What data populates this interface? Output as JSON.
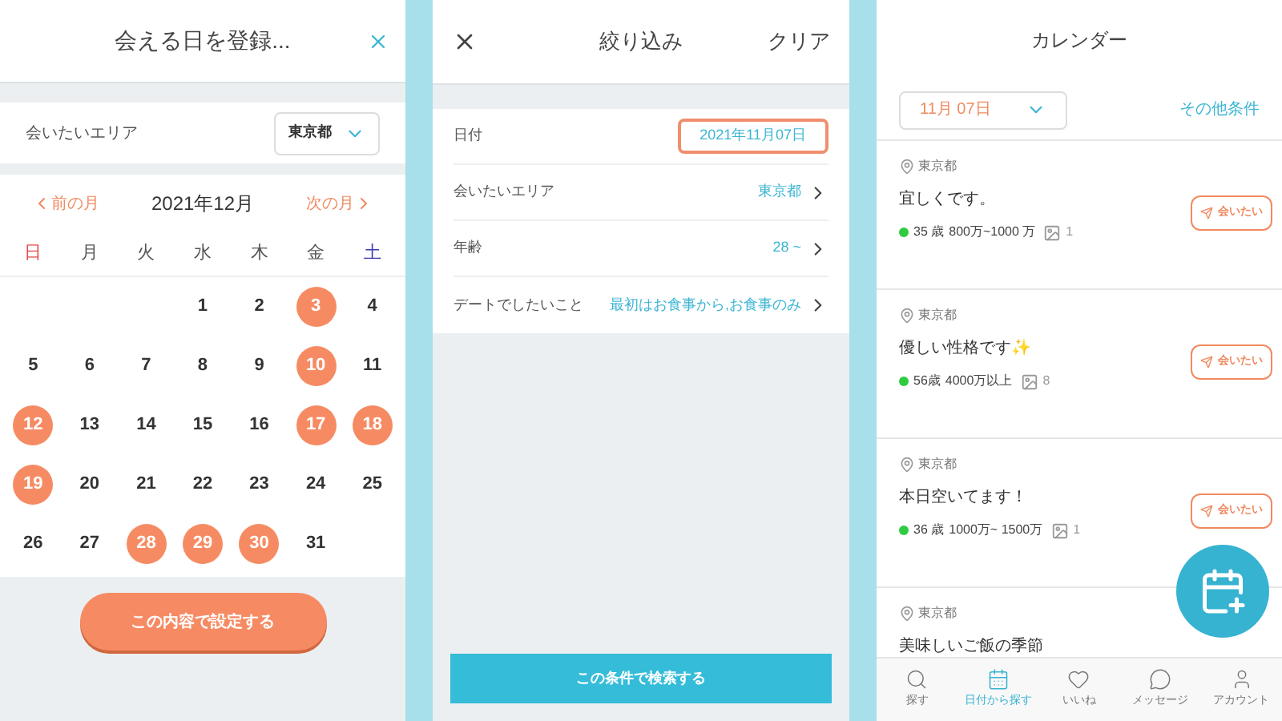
{
  "register_panel": {
    "title": "会える日を登録...",
    "area": {
      "label": "会いたいエリア",
      "value": "東京都"
    },
    "month_nav": {
      "prev": "前の月",
      "current": "2021年12月",
      "next": "次の月"
    },
    "weekdays": [
      {
        "label": "日",
        "color": "#e5484d"
      },
      {
        "label": "月",
        "color": "#555555"
      },
      {
        "label": "火",
        "color": "#555555"
      },
      {
        "label": "水",
        "color": "#555555"
      },
      {
        "label": "木",
        "color": "#555555"
      },
      {
        "label": "金",
        "color": "#555555"
      },
      {
        "label": "土",
        "color": "#3b3bb0"
      }
    ],
    "weeks": [
      {
        "right_aligned": true,
        "days": [
          {
            "day": "1",
            "selected": false
          },
          {
            "day": "2",
            "selected": false
          },
          {
            "day": "3",
            "selected": true
          },
          {
            "day": "4",
            "selected": false
          }
        ]
      },
      {
        "right_aligned": false,
        "days": [
          {
            "day": "5",
            "selected": false
          },
          {
            "day": "6",
            "selected": false
          },
          {
            "day": "7",
            "selected": false
          },
          {
            "day": "8",
            "selected": false
          },
          {
            "day": "9",
            "selected": false
          },
          {
            "day": "10",
            "selected": true
          },
          {
            "day": "11",
            "selected": false
          }
        ]
      },
      {
        "right_aligned": false,
        "days": [
          {
            "day": "12",
            "selected": true
          },
          {
            "day": "13",
            "selected": false
          },
          {
            "day": "14",
            "selected": false
          },
          {
            "day": "15",
            "selected": false
          },
          {
            "day": "16",
            "selected": false
          },
          {
            "day": "17",
            "selected": true
          },
          {
            "day": "18",
            "selected": true
          }
        ]
      },
      {
        "right_aligned": false,
        "days": [
          {
            "day": "19",
            "selected": true
          },
          {
            "day": "20",
            "selected": false
          },
          {
            "day": "21",
            "selected": false
          },
          {
            "day": "22",
            "selected": false
          },
          {
            "day": "23",
            "selected": false
          },
          {
            "day": "24",
            "selected": false
          },
          {
            "day": "25",
            "selected": false
          }
        ]
      },
      {
        "right_aligned": false,
        "days": [
          {
            "day": "26",
            "selected": false
          },
          {
            "day": "27",
            "selected": false
          },
          {
            "day": "28",
            "selected": true
          },
          {
            "day": "29",
            "selected": true
          },
          {
            "day": "30",
            "selected": true
          },
          {
            "day": "31",
            "selected": false
          }
        ]
      }
    ],
    "submit": "この内容で設定する"
  },
  "filter_panel": {
    "title": "絞り込み",
    "clear": "クリア",
    "rows": [
      {
        "label": "日付",
        "value": "2021年11月07日",
        "highlighted": true,
        "chevron": false
      },
      {
        "label": "会いたいエリア",
        "value": "東京都",
        "highlighted": false,
        "chevron": true
      },
      {
        "label": "年齢",
        "value": "28 ~",
        "highlighted": false,
        "chevron": true
      },
      {
        "label": "デートでしたいこと",
        "value": "最初はお食事から,お食事のみ",
        "highlighted": false,
        "chevron": true
      }
    ],
    "search": "この条件で検索する"
  },
  "calendar_panel": {
    "title": "カレンダー",
    "date": "11月 07日",
    "other": "その他条件",
    "cards": [
      {
        "location": "東京都",
        "message": "宜しくです。",
        "online": true,
        "age": "35 歳",
        "income": "800万~1000 万",
        "photos": "1",
        "button": "会いたい"
      },
      {
        "location": "東京都",
        "message": "優しい性格です✨",
        "online": true,
        "age": "56歳",
        "income": "4000万以上",
        "photos": "8",
        "button": "会いたい"
      },
      {
        "location": "東京都",
        "message": "本日空いてます！",
        "online": true,
        "age": "36 歳",
        "income": "1000万~ 1500万",
        "photos": "1",
        "button": "会いたい"
      },
      {
        "location": "東京都",
        "message": "美味しいご飯の季節"
      }
    ],
    "tabs": [
      {
        "label": "探す",
        "selected": false
      },
      {
        "label": "日付から探す",
        "selected": true
      },
      {
        "label": "いいね",
        "selected": false
      },
      {
        "label": "メッセージ",
        "selected": false
      },
      {
        "label": "アカウント",
        "selected": false
      }
    ]
  }
}
